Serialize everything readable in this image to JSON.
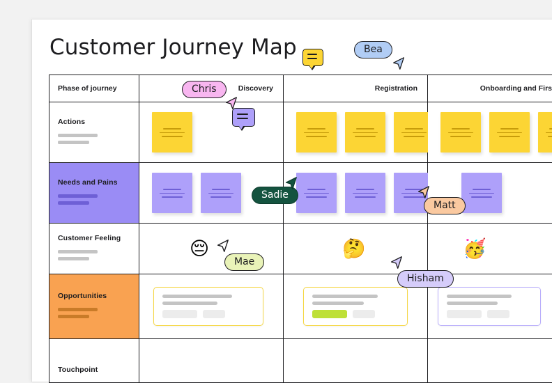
{
  "board": {
    "title": "Customer Journey Map"
  },
  "table": {
    "row_label_header": "Phase of journey",
    "phases": [
      {
        "label": "Discovery",
        "align": "right"
      },
      {
        "label": "Registration",
        "align": "right"
      },
      {
        "label": "Onboarding and First U",
        "align": "right"
      }
    ],
    "rows": [
      {
        "key": "actions",
        "label": "Actions",
        "band": "none"
      },
      {
        "key": "needs",
        "label": "Needs and Pains",
        "band": "purple"
      },
      {
        "key": "feeling",
        "label": "Customer Feeling",
        "band": "none"
      },
      {
        "key": "opportunities",
        "label": "Opportunities",
        "band": "orange"
      },
      {
        "key": "touchpoint",
        "label": "Touchpoint",
        "band": "none"
      }
    ],
    "actions_notes": {
      "discovery": 1,
      "registration": 3,
      "onboarding": 3
    },
    "needs_notes": {
      "discovery": 2,
      "registration": 3,
      "onboarding": 1
    },
    "feelings": [
      {
        "column": "discovery",
        "emoji": "😔",
        "name": "pensive-face-emoji"
      },
      {
        "column": "registration",
        "emoji": "🤔",
        "name": "thinking-face-emoji"
      },
      {
        "column": "onboarding",
        "emoji": "🥳",
        "name": "partying-face-emoji"
      }
    ],
    "opportunities": [
      {
        "column": "discovery",
        "border": "yellow",
        "chips": [
          "plain",
          "plain"
        ]
      },
      {
        "column": "registration",
        "border": "yellow",
        "chips": [
          "lime",
          "plain"
        ]
      },
      {
        "column": "onboarding",
        "border": "purple",
        "chips": [
          "plain",
          "plain"
        ]
      }
    ]
  },
  "cursors": [
    {
      "name": "Chris",
      "color": "#f8b6f0"
    },
    {
      "name": "Bea",
      "color": "#b1cdf5"
    },
    {
      "name": "Sadie",
      "color": "#14533f"
    },
    {
      "name": "Matt",
      "color": "#fac9a0"
    },
    {
      "name": "Mae",
      "color": "#e9f3b8"
    },
    {
      "name": "Hisham",
      "color": "#d5ccfa"
    }
  ],
  "comments": [
    {
      "id": "title-comment",
      "color": "#fcd534"
    },
    {
      "id": "note-comment",
      "color": "#aea0fa"
    }
  ],
  "colors": {
    "band_purple": "#9a8cf5",
    "band_orange": "#f9a251",
    "note_yellow": "#fcd534",
    "note_purple": "#aea0fa",
    "card_yellow_border": "#f5d745",
    "card_purple_border": "#b9aefb",
    "chip_lime": "#bee037",
    "grid_line": "#1d1d20"
  }
}
